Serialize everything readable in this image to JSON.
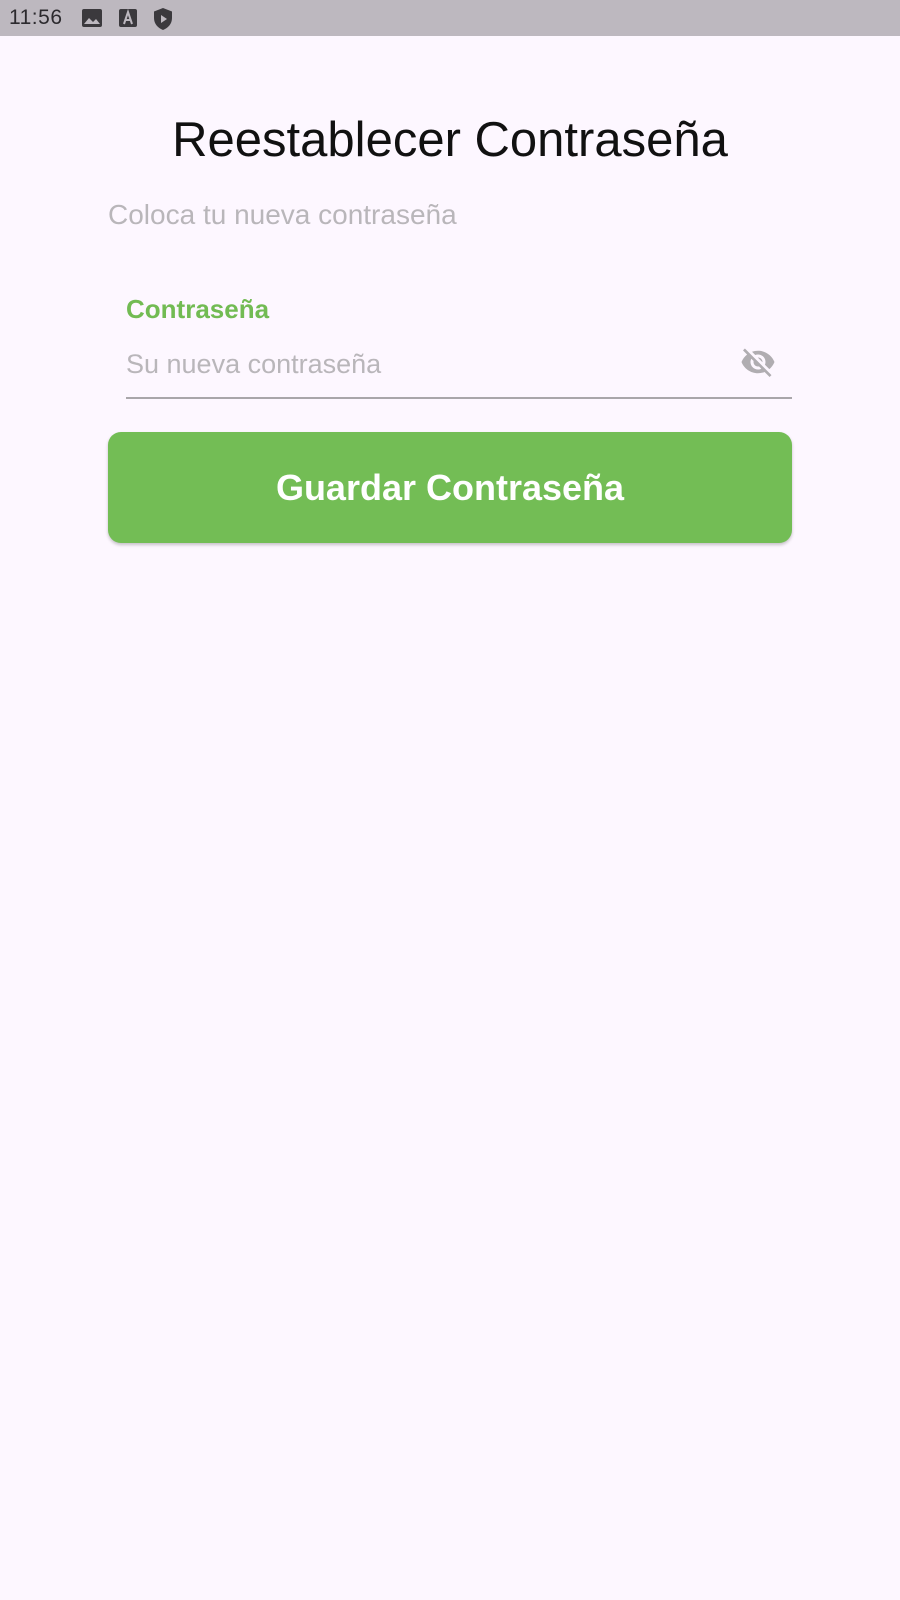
{
  "status_bar": {
    "time": "11:56",
    "icons": [
      "image-icon",
      "font-a-icon",
      "shield-play-icon"
    ],
    "background": "#bdb8bf"
  },
  "page": {
    "title": "Reestablecer Contraseña",
    "subtitle": "Coloca tu nueva contraseña"
  },
  "password_field": {
    "label": "Contraseña",
    "value": "",
    "placeholder": "Su nueva contraseña",
    "toggle_icon": "visibility-off-icon"
  },
  "save_button": {
    "label": "Guardar Contraseña"
  },
  "colors": {
    "accent": "#73bd55",
    "background": "#fdf7ff",
    "hint": "#b9b6ba"
  }
}
